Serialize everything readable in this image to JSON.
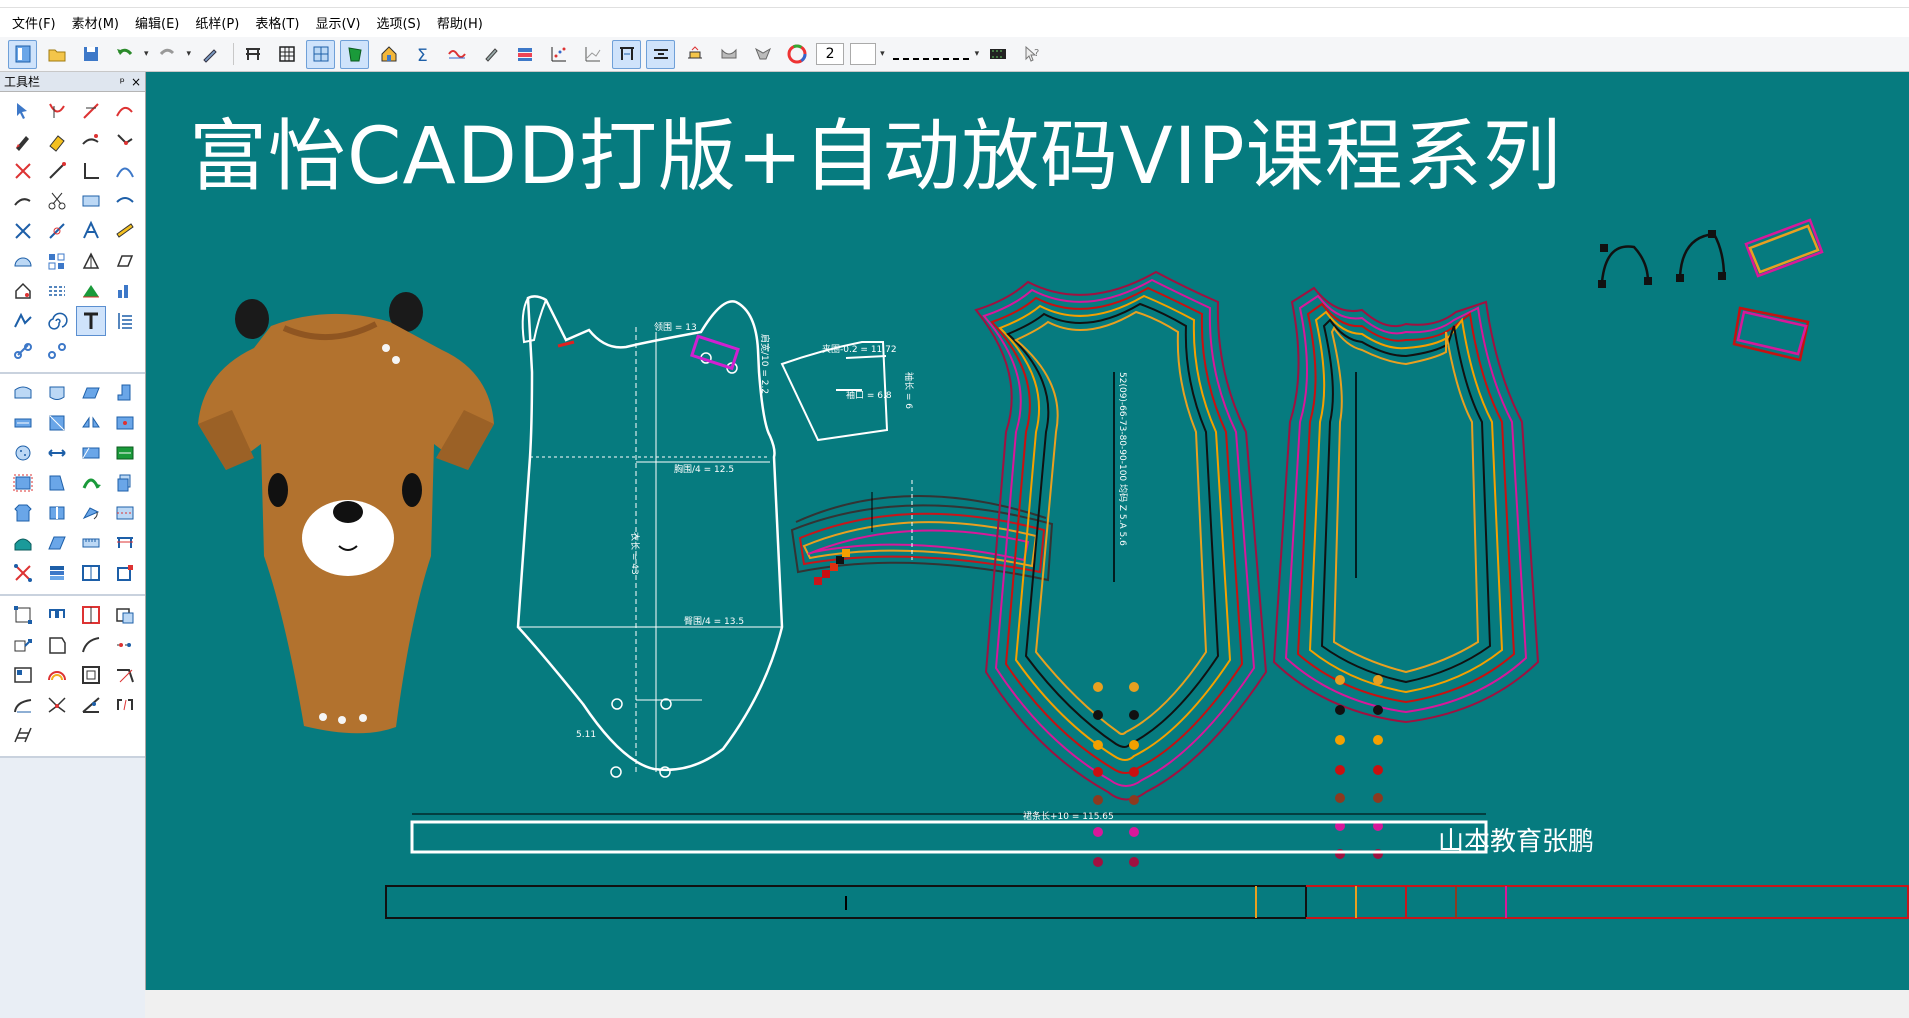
{
  "menu": {
    "items": [
      "文件(F)",
      "素材(M)",
      "编辑(E)",
      "纸样(P)",
      "表格(T)",
      "显示(V)",
      "选项(S)",
      "帮助(H)"
    ]
  },
  "toolbar": {
    "line_width": "2",
    "icons": [
      "select-pattern-icon",
      "open-folder-icon",
      "save-icon",
      "undo-icon",
      "redo-icon",
      "pen-icon",
      "pattern-table-icon",
      "grid-table-icon",
      "pattern-view-icon",
      "green-piece-icon",
      "home-tools-icon",
      "sigma-icon",
      "wave-icon",
      "brush-icon",
      "layer-icon",
      "dots-icon",
      "chart-icon",
      "measure-icon",
      "resize-icon",
      "grading-icon",
      "sleeve-icon",
      "collar-icon",
      "color-wheel-icon"
    ]
  },
  "panel": {
    "title": "工具栏",
    "pin": "ᵖ",
    "close": "×"
  },
  "canvas": {
    "title": "富怡CADD打版+自动放码VIP课程系列",
    "brand": "山本教育张鹏",
    "length_label": "裙条长+10 = 115.65",
    "bg_color": "#067b7f",
    "dimensions": {
      "chest": "胸围/4 = 12.5",
      "hip": "臀围/4 = 13.5",
      "back_width": "肩宽/10 = 2.2",
      "armhole": "夹圈-0.2 = 11.72",
      "sleeve_length": "袖长 = 6",
      "sleeve_width": "袖口 = 6.8",
      "body_length": "衣长 = 43",
      "neck": "领围 = 13",
      "crotch": "5.11",
      "size_text": "52(09)-66-73-80-90-100 均码  Z 5.A 5.6"
    }
  },
  "size_colors": [
    "#e8a020",
    "#111111",
    "#f4a000",
    "#c81010",
    "#8b3a20",
    "#d8189a",
    "#a01040"
  ]
}
